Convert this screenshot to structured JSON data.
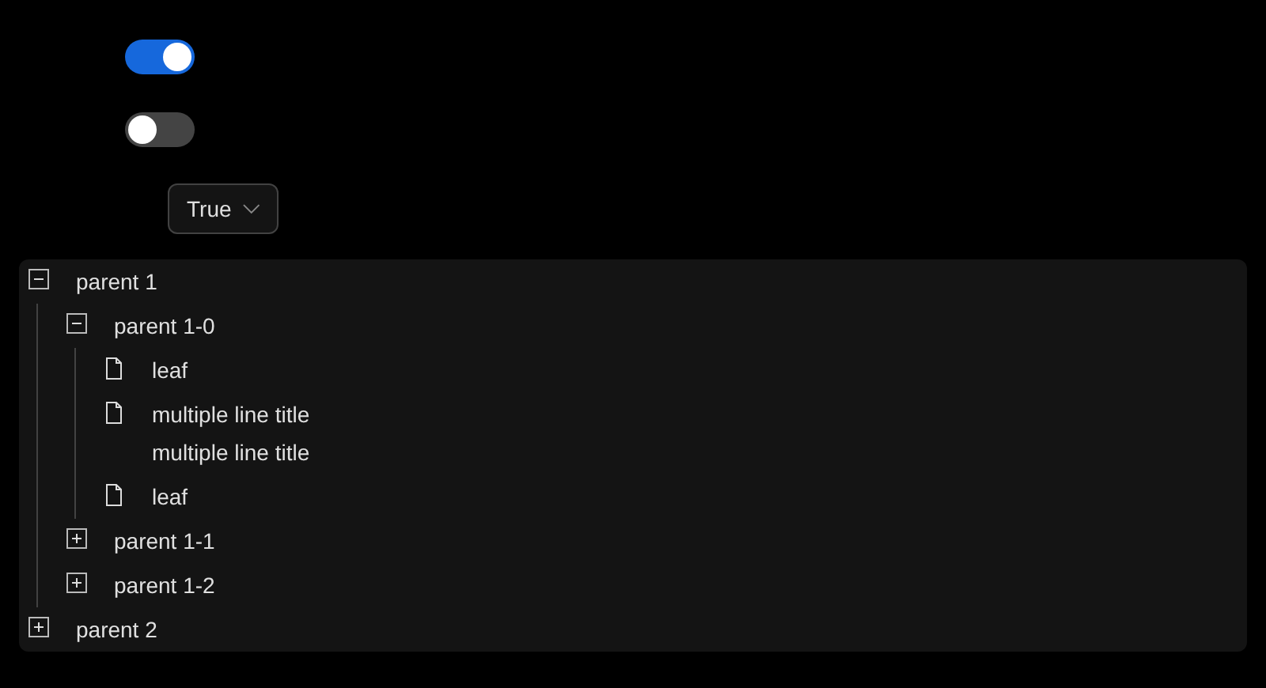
{
  "switches": [
    {
      "on": true
    },
    {
      "on": false
    }
  ],
  "select": {
    "value": "True"
  },
  "tree": [
    {
      "kind": "folder",
      "title": [
        "parent 1"
      ],
      "expanded": true,
      "children": [
        {
          "kind": "folder",
          "title": [
            "parent 1-0"
          ],
          "expanded": true,
          "children": [
            {
              "kind": "leaf",
              "title": [
                "leaf"
              ]
            },
            {
              "kind": "leaf",
              "title": [
                "multiple line title",
                "multiple line title"
              ]
            },
            {
              "kind": "leaf",
              "title": [
                "leaf"
              ]
            }
          ]
        },
        {
          "kind": "folder",
          "title": [
            "parent 1-1"
          ],
          "expanded": false
        },
        {
          "kind": "folder",
          "title": [
            "parent 1-2"
          ],
          "expanded": false
        }
      ]
    },
    {
      "kind": "folder",
      "title": [
        "parent 2"
      ],
      "expanded": false
    }
  ]
}
